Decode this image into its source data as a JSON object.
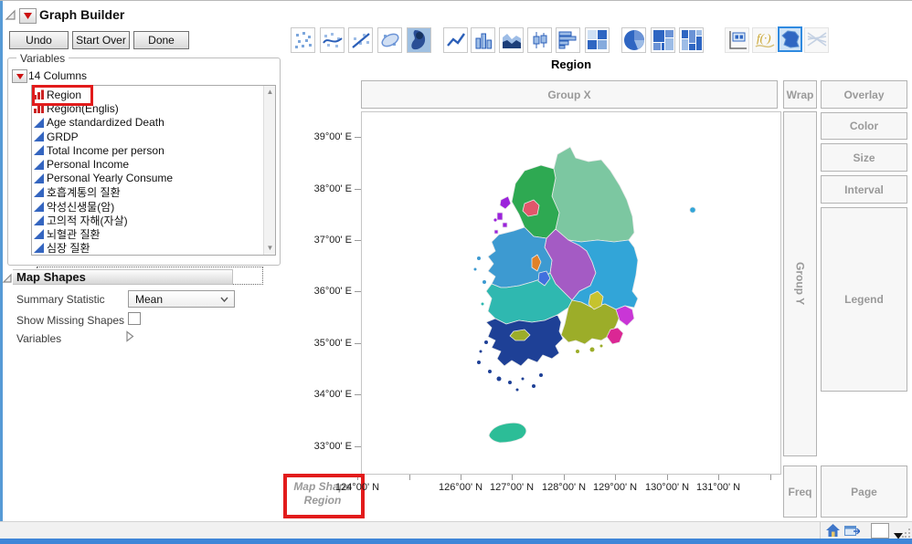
{
  "window": {
    "title": "Graph Builder"
  },
  "actions": [
    "Undo",
    "Start Over",
    "Done"
  ],
  "palette": {
    "selected": "map-shapes",
    "icons": [
      "points",
      "smoother",
      "line-of-fit",
      "ellipse",
      "contour",
      "line",
      "bar",
      "area",
      "box-plot",
      "histogram",
      "heatmap",
      "pie",
      "treemap",
      "mosaic",
      "caption-box",
      "formula",
      "map-shapes",
      "parallel"
    ]
  },
  "variables_panel": {
    "title": "Variables",
    "columns_label": "14 Columns",
    "items": [
      {
        "label": "Region",
        "type": "nominal",
        "highlighted": true
      },
      {
        "label": "Region(Englis)",
        "type": "nominal"
      },
      {
        "label": "Age standardized Death",
        "type": "continuous"
      },
      {
        "label": "GRDP",
        "type": "continuous"
      },
      {
        "label": "Total Income per person",
        "type": "continuous"
      },
      {
        "label": "Personal Income",
        "type": "continuous"
      },
      {
        "label": "Personal Yearly Consume",
        "type": "continuous"
      },
      {
        "label": "호흡계통의 질환",
        "type": "continuous"
      },
      {
        "label": "악성신생물(암)",
        "type": "continuous"
      },
      {
        "label": "고의적 자해(자살)",
        "type": "continuous"
      },
      {
        "label": "뇌혈관 질환",
        "type": "continuous"
      },
      {
        "label": "심장 질환",
        "type": "continuous"
      }
    ]
  },
  "map_shapes_panel": {
    "title": "Map Shapes",
    "summary_statistic_label": "Summary Statistic",
    "summary_statistic_value": "Mean",
    "show_missing_label": "Show Missing Shapes",
    "show_missing_checked": false,
    "variables_label": "Variables"
  },
  "graph": {
    "title": "Region",
    "zones": {
      "group_x": "Group X",
      "wrap": "Wrap",
      "overlay": "Overlay",
      "color": "Color",
      "size": "Size",
      "interval": "Interval",
      "legend": "Legend",
      "group_y": "Group Y",
      "freq": "Freq",
      "page": "Page"
    },
    "map_shape_annotation": {
      "line1": "Map Shape",
      "line2": "Region"
    },
    "y_axis": {
      "labels": [
        "39°00' E",
        "38°00' E",
        "37°00' E",
        "36°00' E",
        "35°00' E",
        "34°00' E",
        "33°00' E"
      ]
    },
    "x_axis": {
      "labels": [
        "124°00' N",
        "126°00' N",
        "127°00' N",
        "128°00' N",
        "129°00' N",
        "130°00' N",
        "131°00' N"
      ]
    }
  },
  "map": {
    "region_colors": {
      "gangwon": "#7CC7A1",
      "gyeonggi": "#2EA952",
      "seoul": "#E2566B",
      "incheon": "#9B23DB",
      "chungbuk": "#A45BC4",
      "chungnam": "#3D9AD1",
      "sejong": "#E08128",
      "daejeon": "#4170DE",
      "gyeongbuk": "#32A5D8",
      "jeonbuk": "#2FB8B0",
      "daegu": "#C6C32E",
      "gyeongnam": "#9CAD29",
      "ulsan": "#C936D6",
      "busan": "#DB2794",
      "jeonnam": "#1E4096",
      "gwangju": "#9CAD29",
      "jeju": "#2CBD97",
      "ulleungdo": "#32A5D8"
    }
  },
  "status_bar": {
    "icons": [
      "home-icon",
      "window-icon",
      "color-swatch",
      "dropdown-arrow",
      "resize-grip"
    ]
  }
}
